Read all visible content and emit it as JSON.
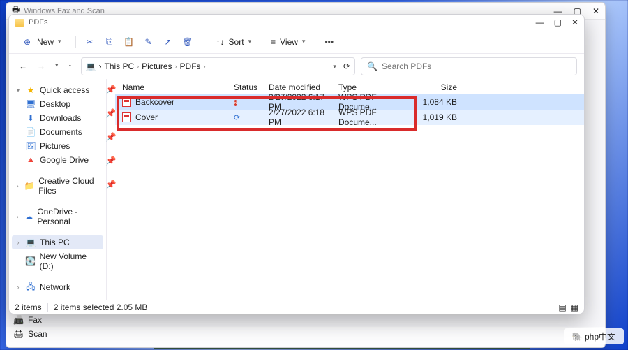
{
  "bg_window": {
    "title": "Windows Fax and Scan",
    "left_items": [
      "Fax",
      "Scan"
    ]
  },
  "explorer": {
    "title": "PDFs",
    "toolbar": {
      "new": "New",
      "sort": "Sort",
      "view": "View"
    },
    "breadcrumb": [
      "This PC",
      "Pictures",
      "PDFs"
    ],
    "search_placeholder": "Search PDFs",
    "columns": {
      "name": "Name",
      "status": "Status",
      "date": "Date modified",
      "type": "Type",
      "size": "Size"
    },
    "sidebar": {
      "quick": "Quick access",
      "items": [
        "Desktop",
        "Downloads",
        "Documents",
        "Pictures",
        "Google Drive"
      ],
      "cloud1": "Creative Cloud Files",
      "cloud2": "OneDrive - Personal",
      "thispc": "This PC",
      "vol": "New Volume (D:)",
      "net": "Network"
    },
    "files": [
      {
        "name": "Backcover",
        "status": "error",
        "date": "2/27/2022 6:17 PM",
        "type": "WPS PDF Docume...",
        "size": "1,084 KB"
      },
      {
        "name": "Cover",
        "status": "sync",
        "date": "2/27/2022 6:18 PM",
        "type": "WPS PDF Docume...",
        "size": "1,019 KB"
      }
    ],
    "statusbar": {
      "count": "2 items",
      "selected": "2 items selected  2.05 MB"
    }
  },
  "watermark": "php中文"
}
